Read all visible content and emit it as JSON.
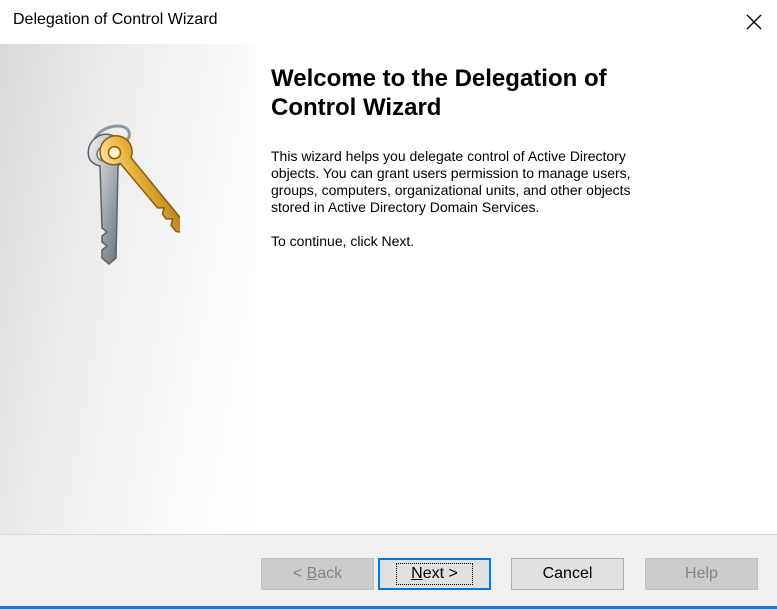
{
  "window": {
    "title": "Delegation of Control Wizard"
  },
  "icons": {
    "close": "close-icon",
    "illustration": "keys-icon"
  },
  "main": {
    "heading": "Welcome to the Delegation of\nControl Wizard",
    "paragraph1": "This wizard helps you delegate control of Active Directory\nobjects. You can grant users permission to manage users,\ngroups, computers, organizational units, and other objects\nstored in Active Directory Domain Services.",
    "paragraph2": "To continue, click Next."
  },
  "buttons": {
    "back": {
      "prefix": "< ",
      "mnemonic": "B",
      "rest": "ack",
      "enabled": false
    },
    "next": {
      "mnemonic": "N",
      "rest": "ext >",
      "enabled": true,
      "default": true
    },
    "cancel": {
      "label": "Cancel",
      "enabled": true
    },
    "help": {
      "label": "Help",
      "enabled": false
    }
  },
  "colors": {
    "accent": "#0078d7",
    "window_border": "#1e78c8",
    "button_bar": "#f0f0f0"
  }
}
